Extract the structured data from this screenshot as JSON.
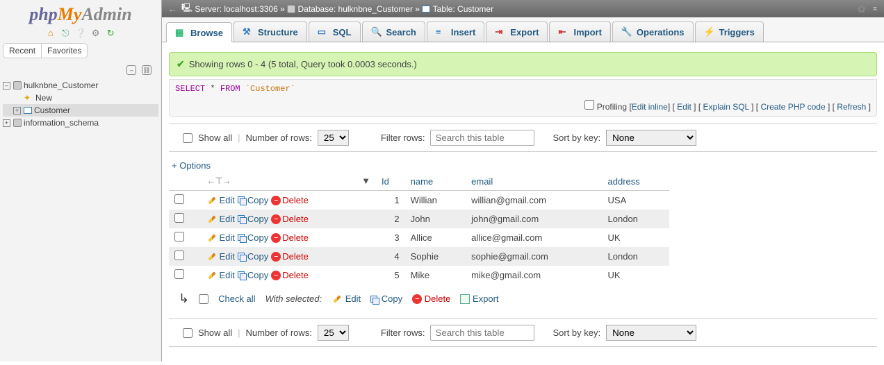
{
  "logo": {
    "p1": "php",
    "p2": "My",
    "p3": "Admin"
  },
  "sidebar": {
    "tabs": [
      "Recent",
      "Favorites"
    ],
    "tree": [
      {
        "label": "hulknbne_Customer",
        "expanded": true
      },
      {
        "label": "New",
        "indent": 1
      },
      {
        "label": "Customer",
        "indent": 1,
        "selected": true,
        "toggle": "+"
      },
      {
        "label": "information_schema",
        "toggle": "+"
      }
    ]
  },
  "breadcrumb": {
    "server_lbl": "Server:",
    "server": "localhost:3306",
    "db_lbl": "Database:",
    "db": "hulknbne_Customer",
    "tbl_lbl": "Table:",
    "tbl": "Customer",
    "sep": "»"
  },
  "tabs": [
    "Browse",
    "Structure",
    "SQL",
    "Search",
    "Insert",
    "Export",
    "Import",
    "Operations",
    "Triggers"
  ],
  "active_tab": 0,
  "success_msg": "Showing rows 0 - 4 (5 total, Query took 0.0003 seconds.)",
  "sql": {
    "select": "SELECT",
    "star": "*",
    "from": "FROM",
    "table": "`Customer`"
  },
  "query_actions": {
    "profiling": "Profiling",
    "edit_inline": "Edit inline",
    "edit": "Edit",
    "explain": "Explain SQL",
    "create_php": "Create PHP code",
    "refresh": "Refresh"
  },
  "controls": {
    "show_all": "Show all",
    "num_rows_lbl": "Number of rows:",
    "num_rows": "25",
    "filter_lbl": "Filter rows:",
    "filter_placeholder": "Search this table",
    "sort_lbl": "Sort by key:",
    "sort_val": "None"
  },
  "options_link": "+ Options",
  "columns": [
    "Id",
    "name",
    "email",
    "address"
  ],
  "row_actions": {
    "edit": "Edit",
    "copy": "Copy",
    "delete": "Delete"
  },
  "rows": [
    {
      "id": "1",
      "name": "Willian",
      "email": "willian@gmail.com",
      "address": "USA"
    },
    {
      "id": "2",
      "name": "John",
      "email": "john@gmail.com",
      "address": "London"
    },
    {
      "id": "3",
      "name": "Allice",
      "email": "allice@gmail.com",
      "address": "UK"
    },
    {
      "id": "4",
      "name": "Sophie",
      "email": "sophie@gmail.com",
      "address": "London"
    },
    {
      "id": "5",
      "name": "Mike",
      "email": "mike@gmail.com",
      "address": "UK"
    }
  ],
  "bulk": {
    "check_all": "Check all",
    "with_selected": "With selected:",
    "edit": "Edit",
    "copy": "Copy",
    "delete": "Delete",
    "export": "Export"
  }
}
